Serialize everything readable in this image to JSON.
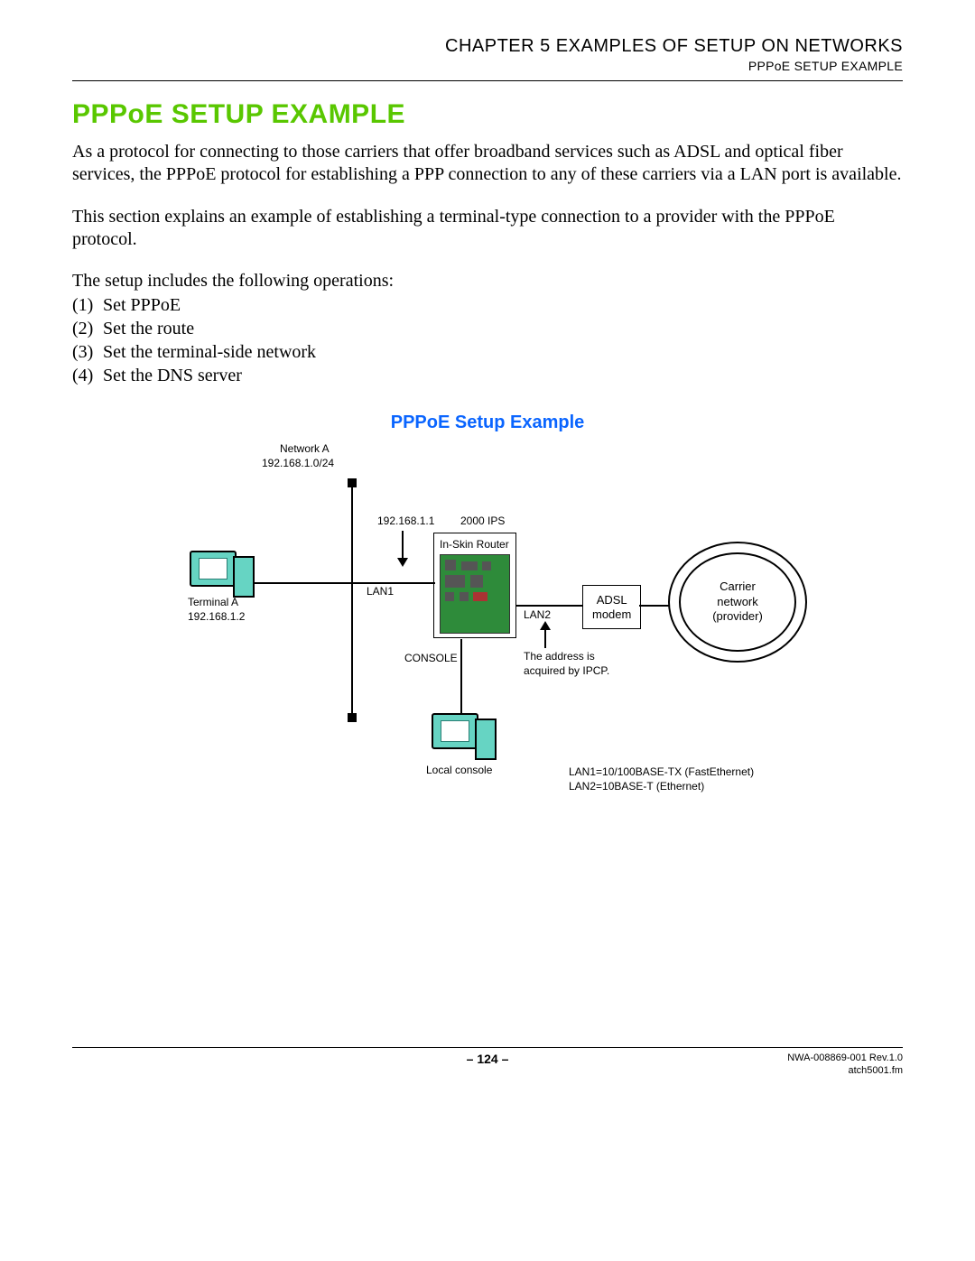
{
  "header": {
    "chapter": "CHAPTER 5   EXAMPLES OF SETUP ON NETWORKS",
    "subtitle": "PPPoE SETUP EXAMPLE"
  },
  "title": "PPPoE SETUP EXAMPLE",
  "paragraphs": {
    "p1": "As a protocol for connecting to those carriers that offer broadband services such as ADSL and optical fiber services, the PPPoE protocol for establishing a PPP connection to any of these carriers via a LAN port is available.",
    "p2": "This section explains an example of establishing a terminal-type connection to a provider with the PPPoE protocol.",
    "ops_intro": "The setup includes the following operations:"
  },
  "ops": [
    {
      "n": "(1)",
      "t": "Set PPPoE"
    },
    {
      "n": "(2)",
      "t": "Set the route"
    },
    {
      "n": "(3)",
      "t": "Set the terminal-side network"
    },
    {
      "n": "(4)",
      "t": "Set the DNS server"
    }
  ],
  "diagram": {
    "title": "PPPoE Setup Example",
    "labels": {
      "network_a": "Network A",
      "network_a_sub": "192.168.1.0/24",
      "ip_lan1": "192.168.1.1",
      "ips": "2000 IPS",
      "in_skin": "In-Skin Router",
      "terminal_a": "Terminal A",
      "terminal_a_ip": "192.168.1.2",
      "lan1": "LAN1",
      "lan2": "LAN2",
      "console": "CONSOLE",
      "adsl1": "ADSL",
      "adsl2": "modem",
      "carrier1": "Carrier",
      "carrier2": "network",
      "carrier3": "(provider)",
      "ipcp1": "The address is",
      "ipcp2": "acquired by IPCP.",
      "local_console": "Local console",
      "lan_note1": "LAN1=10/100BASE-TX (FastEthernet)",
      "lan_note2": "LAN2=10BASE-T (Ethernet)"
    }
  },
  "footer": {
    "page": "– 124 –",
    "rev": "NWA-008869-001 Rev.1.0",
    "file": "atch5001.fm"
  }
}
